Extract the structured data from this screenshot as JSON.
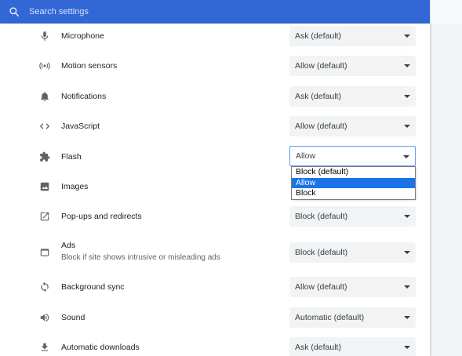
{
  "search": {
    "placeholder": "Search settings"
  },
  "rows": [
    {
      "label": "Microphone",
      "value": "Ask (default)",
      "icon": "microphone-icon"
    },
    {
      "label": "Motion sensors",
      "value": "Allow (default)",
      "icon": "motion-sensors-icon"
    },
    {
      "label": "Notifications",
      "value": "Ask (default)",
      "icon": "bell-icon"
    },
    {
      "label": "JavaScript",
      "value": "Allow (default)",
      "icon": "code-icon"
    },
    {
      "label": "Flash",
      "value": "Allow",
      "icon": "puzzle-icon"
    },
    {
      "label": "Images",
      "value": "",
      "icon": "image-icon"
    },
    {
      "label": "Pop-ups and redirects",
      "value": "Block (default)",
      "icon": "open-in-new-icon"
    },
    {
      "label": "Ads",
      "sublabel": "Block if site shows intrusive or misleading ads",
      "value": "Block (default)",
      "icon": "web-asset-icon"
    },
    {
      "label": "Background sync",
      "value": "Allow (default)",
      "icon": "sync-icon"
    },
    {
      "label": "Sound",
      "value": "Automatic (default)",
      "icon": "volume-icon"
    },
    {
      "label": "Automatic downloads",
      "value": "Ask (default)",
      "icon": "download-icon"
    }
  ],
  "flash_dropdown": {
    "options": [
      "Block (default)",
      "Allow",
      "Block"
    ],
    "selected": "Allow"
  },
  "colors": {
    "header": "#3367d6",
    "selected_option": "#1a73e8"
  }
}
